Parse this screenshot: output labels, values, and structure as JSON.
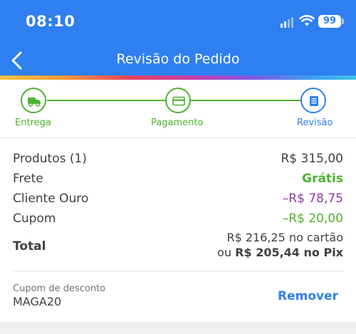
{
  "status_bar": {
    "time": "08:10",
    "battery": "99"
  },
  "header": {
    "title": "Revisão do Pedido",
    "color": "#2f7ff0"
  },
  "steps": [
    {
      "label": "Entrega",
      "icon": "truck-icon",
      "state": "done"
    },
    {
      "label": "Pagamento",
      "icon": "credit-card-icon",
      "state": "done"
    },
    {
      "label": "Revisão",
      "icon": "document-icon",
      "state": "current"
    }
  ],
  "summary": {
    "products_label": "Produtos (1)",
    "products_value": "R$ 315,00",
    "shipping_label": "Frete",
    "shipping_value": "Grátis",
    "gold_label": "Cliente Ouro",
    "gold_value": "–R$ 78,75",
    "coupon_label": "Cupom",
    "coupon_value": "–R$ 20,00",
    "total_label": "Total",
    "total_card": "R$ 216,25 no cartão",
    "total_pix_prefix": "ou ",
    "total_pix": "R$ 205,44 no Pix"
  },
  "coupon": {
    "caption": "Cupom de desconto",
    "code": "MAGA20",
    "remove_label": "Remover"
  }
}
